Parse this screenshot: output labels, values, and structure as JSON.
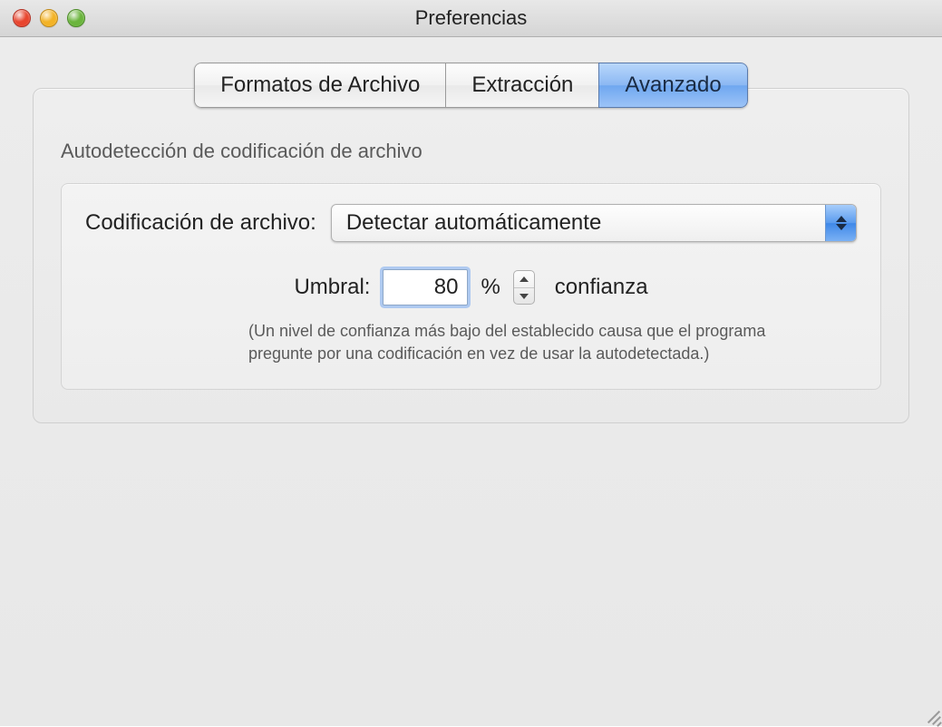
{
  "window": {
    "title": "Preferencias"
  },
  "tabs": [
    {
      "label": "Formatos de Archivo",
      "active": false
    },
    {
      "label": "Extracción",
      "active": false
    },
    {
      "label": "Avanzado",
      "active": true
    }
  ],
  "section": {
    "heading": "Autodetección de codificación de archivo",
    "encoding_label": "Codificación de archivo:",
    "encoding_value": "Detectar automáticamente",
    "threshold_label": "Umbral:",
    "threshold_value": "80",
    "percent_symbol": "%",
    "confidence_label": "confianza",
    "help_text": "(Un nivel de confianza más bajo del establecido causa que el programa pregunte por una codificación en vez de usar la autodetectada.)"
  }
}
